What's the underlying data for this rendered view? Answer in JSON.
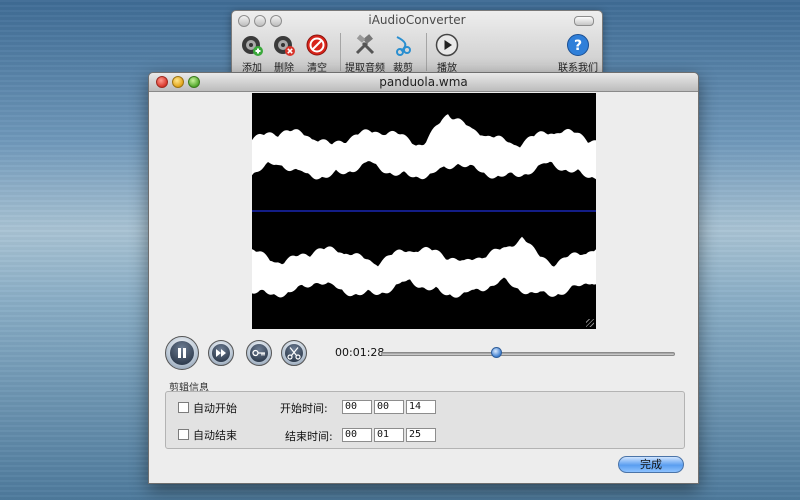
{
  "main_window": {
    "title": "iAudioConverter",
    "toolbar": {
      "add_label": "添加",
      "delete_label": "删除",
      "clear_label": "清空",
      "extract_label": "提取音频",
      "trim_label": "裁剪",
      "play_label": "播放",
      "contact_label": "联系我们"
    }
  },
  "editor": {
    "title": "panduola.wma",
    "current_time": "00:01:28",
    "progress_fraction": 0.39,
    "clip_group_label": "剪辑信息",
    "auto_start_label": "自动开始",
    "auto_end_label": "自动结束",
    "auto_start_checked": false,
    "auto_end_checked": false,
    "start_time_label": "开始时间:",
    "end_time_label": "结束时间:",
    "start_h": "00",
    "start_m": "00",
    "start_s": "14",
    "end_h": "00",
    "end_m": "01",
    "end_s": "25",
    "done_label": "完成"
  },
  "colors": {
    "waveform_fill": "#ffffff",
    "waveform_bg": "#000000",
    "channel_divider": "#1f2fd8",
    "accent_blue": "#3f7fcf"
  },
  "icons": [
    "add-icon",
    "delete-icon",
    "clear-icon",
    "extract-audio-icon",
    "trim-icon",
    "play-icon",
    "help-icon",
    "pause-icon",
    "fast-forward-icon",
    "key-icon",
    "scissors-icon"
  ]
}
